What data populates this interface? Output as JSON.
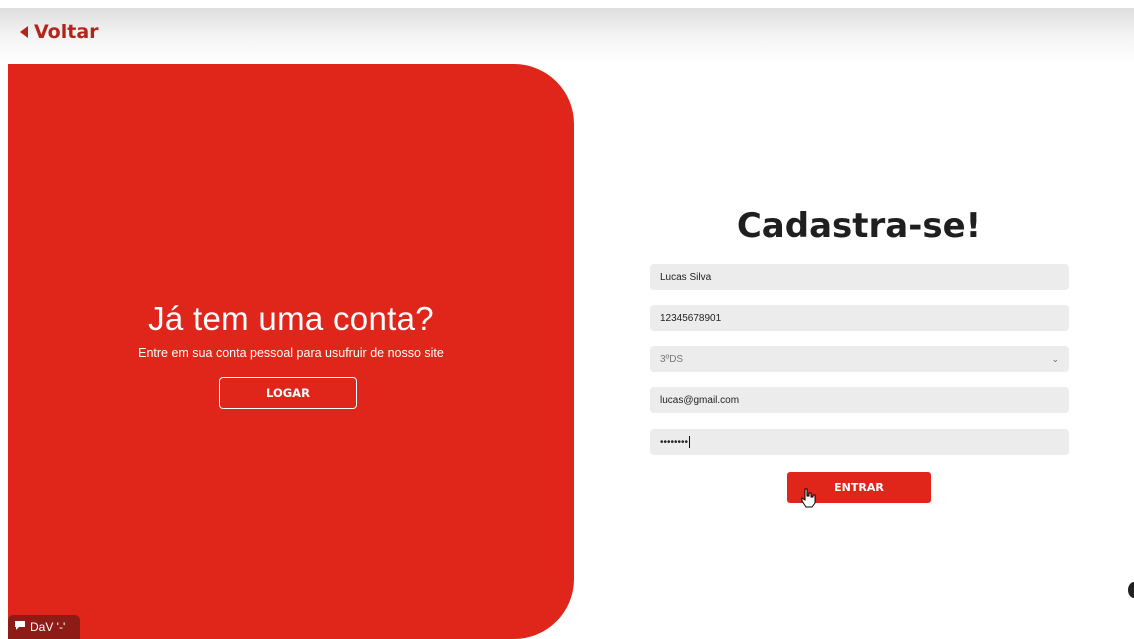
{
  "header": {
    "back_label": "Voltar"
  },
  "left_panel": {
    "title": "Já tem uma conta?",
    "subtitle": "Entre em sua conta pessoal para usufruir de nosso site",
    "login_button": "LOGAR"
  },
  "form": {
    "title": "Cadastra-se!",
    "name_value": "Lucas Silva",
    "id_value": "12345678901",
    "class_select_value": "3ºDS",
    "email_value": "lucas@gmail.com",
    "password_masked": "••••••••",
    "submit_button": "ENTRAR"
  },
  "footer_badge": {
    "label": "DaV '-'"
  },
  "colors": {
    "brand_red": "#e0261a",
    "dark_red": "#b3241a",
    "field_bg": "#ececec"
  }
}
